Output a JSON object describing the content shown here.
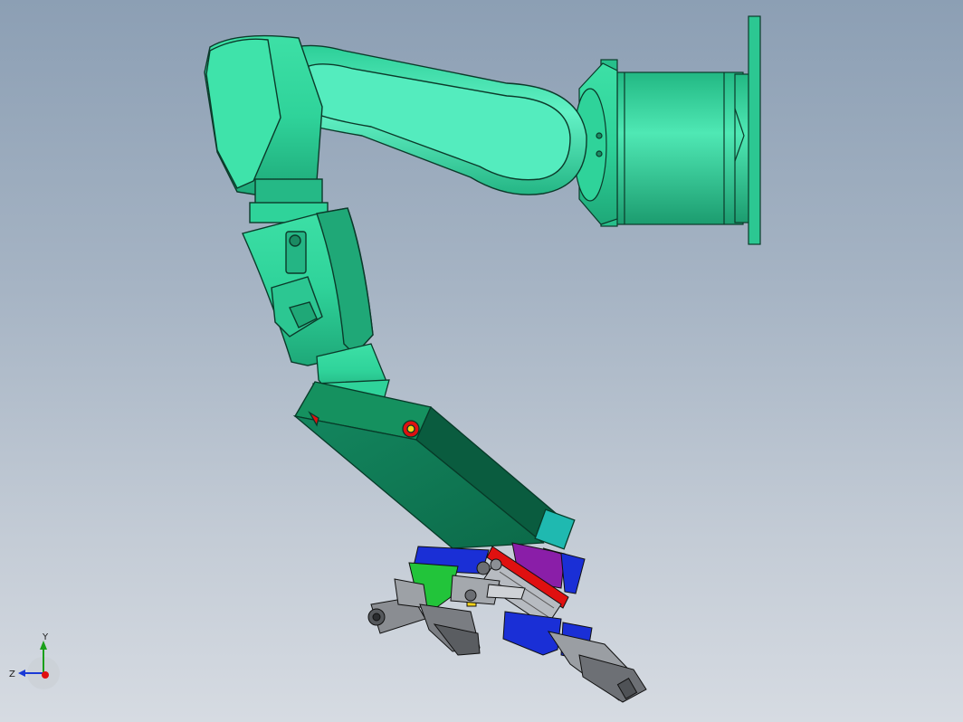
{
  "viewport": {
    "background_top": "#8c9fb4",
    "background_bottom": "#d6dbe2"
  },
  "model": {
    "body_color": "#2fd39a",
    "body_highlight": "#5ff0c2",
    "body_edge": "#0b3a2a",
    "effector_color": "#0f7a55",
    "bracket_blue": "#1a2fd6",
    "bracket_green": "#22c43a",
    "bracket_purple": "#8a1ea8",
    "accent_red": "#e01010",
    "accent_yellow": "#f2d21a",
    "gripper_gray": "#7a7d82"
  },
  "triad": {
    "y_label": "Y",
    "z_label": "Z"
  }
}
